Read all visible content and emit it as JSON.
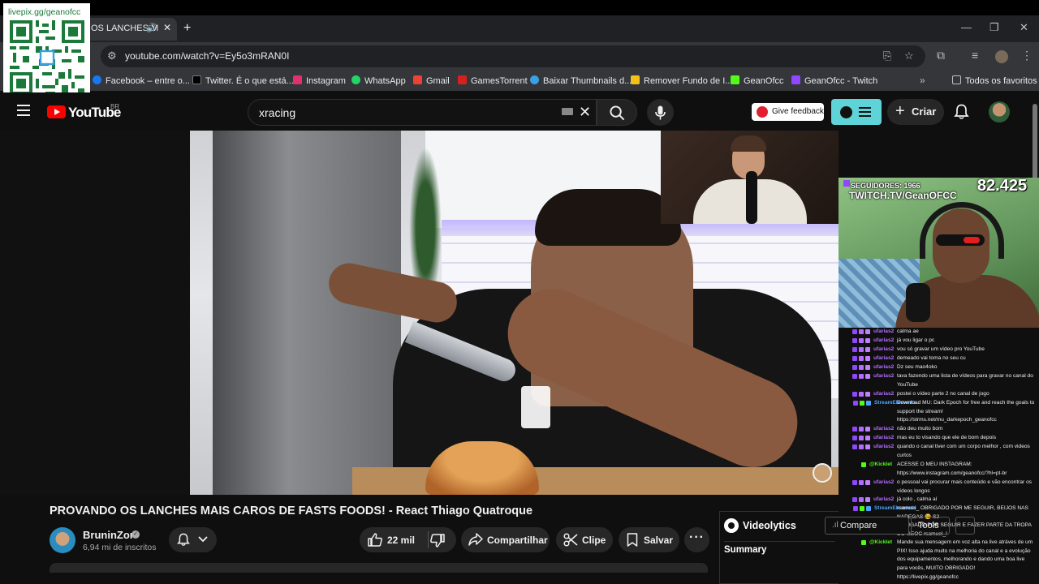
{
  "browser": {
    "tab_title": "OS LANCHES M",
    "url": "youtube.com/watch?v=Ey5o3mRAN0I",
    "bookmarks": [
      {
        "label": "Facebook – entre o...",
        "color": "#1877f2"
      },
      {
        "label": "Twitter. É o que está...",
        "color": "#000000"
      },
      {
        "label": "Instagram",
        "color": "#e1306c"
      },
      {
        "label": "WhatsApp",
        "color": "#25d366"
      },
      {
        "label": "Gmail",
        "color": "#ea4335"
      },
      {
        "label": "GamesTorrent",
        "color": "#d62020"
      },
      {
        "label": "Baixar Thumbnails d...",
        "color": "#3aa0e0"
      },
      {
        "label": "Remover Fundo de I...",
        "color": "#f2c21a"
      },
      {
        "label": "GeanOfcc",
        "color": "#53fc18"
      },
      {
        "label": "GeanOfcc - Twitch",
        "color": "#9146ff"
      }
    ],
    "all_favorites": "Todos os favoritos"
  },
  "overlay": {
    "qr_label": "livepix.gg/geanofcc",
    "followers_text": "SEGUIDORES: 1966",
    "twitch_text": "TWITCH.TV/GeanOFCC",
    "viewer_count": "82.425"
  },
  "youtube": {
    "logo_text": "YouTube",
    "country": "BR",
    "search_query": "xracing",
    "feedback_label": "Give feedback",
    "create_label": "Criar"
  },
  "video": {
    "title": "PROVANDO OS LANCHES MAIS CAROS DE FASTS FOODS! - React Thiago Quatroque",
    "channel": "BruninZor",
    "subscribers": "6,94 mi de inscritos",
    "likes": "22 mil",
    "share_label": "Compartilhar",
    "clip_label": "Clipe",
    "save_label": "Salvar"
  },
  "videolytics": {
    "name": "Videolytics",
    "summary": "Summary",
    "compare_label": "Compare",
    "tools_label": "Tools"
  },
  "chat": [
    {
      "user": "ufarias2",
      "color": "#b36cff",
      "msg": "calma ae"
    },
    {
      "user": "ufarias2",
      "color": "#b36cff",
      "msg": "já vou ligar o pc"
    },
    {
      "user": "ufarias2",
      "color": "#b36cff",
      "msg": "vou só gravar um vídeo pro YouTube"
    },
    {
      "user": "ufarias2",
      "color": "#b36cff",
      "msg": "demeado vai toma no seu cu"
    },
    {
      "user": "ufarias2",
      "color": "#b36cff",
      "msg": "Dz seu mao4oko"
    },
    {
      "user": "ufarias2",
      "color": "#b36cff",
      "msg": "tava fazendo uma lista de vídeos para gravar no canal do YouTube"
    },
    {
      "user": "ufarias2",
      "color": "#b36cff",
      "msg": "postei o vídeo parte 2 no canal de jogo"
    },
    {
      "user": "StreamElements",
      "color": "#4aa3ff",
      "msg": "Download MU: Dark Epoch for free and reach the goals to support the stream! https://strms.net/mu_darkepoch_geanofcc"
    },
    {
      "user": "ufarias2",
      "color": "#b36cff",
      "msg": "não deu muito bom"
    },
    {
      "user": "ufarias2",
      "color": "#b36cff",
      "msg": "mas eu to visando que ele de bom depois"
    },
    {
      "user": "ufarias2",
      "color": "#b36cff",
      "msg": "quando o canal tiver com um corpo melhor , com videos curtos"
    },
    {
      "user": "@Kicklet",
      "color": "#53fc18",
      "msg": "ACESSE O MEU INSTAGRAM: https://www.instagram.com/geanofcc/?hl=pt-br"
    },
    {
      "user": "ufarias2",
      "color": "#b36cff",
      "msg": "o pessoal vai procurar mais conteúdo e vão encontrar os vídeos longos"
    },
    {
      "user": "ufarias2",
      "color": "#b36cff",
      "msg": "já colo , calma aí"
    },
    {
      "user": "StreamElements",
      "color": "#4aa3ff",
      "msg": "rsamuel_ OBRIGADO POR ME SEGUIR, BEIJOS NAS NADEGAS 😘 S2"
    },
    {
      "user": "Kicklet",
      "color": "#53fc18",
      "msg": "OBRIGADO POR SEGUIR E FAZER PARTE DA TROPA DO GEOC rsamuel_!"
    },
    {
      "user": "@Kicklet",
      "color": "#53fc18",
      "msg": "Mande sua mensagem em voz alta na live atráves de um PIX! Isso ajuda muito na melhoria do canal e a evolução dos equipamentos, melhorando e dando uma boa live para vocês, MUITO OBRIGADO! https://livepix.gg/geanofcc"
    }
  ]
}
